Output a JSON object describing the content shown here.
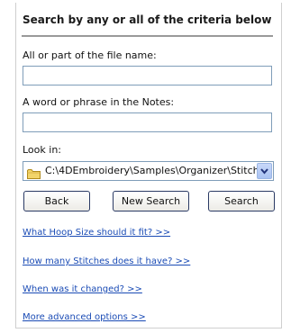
{
  "search": {
    "heading": "Search by any or all of the criteria below",
    "filename_label": "All or part of the file name:",
    "filename_value": "",
    "notes_label": "A word or phrase in the Notes:",
    "notes_value": "",
    "lookin_label": "Look in:",
    "lookin_value": "C:\\4DEmbroidery\\Samples\\Organizer\\Stitch",
    "folder_icon": "folder-icon",
    "dropdown_icon": "chevron-down-icon"
  },
  "buttons": {
    "back": "Back",
    "new_search": "New Search",
    "search": "Search"
  },
  "links": [
    "What Hoop Size should it fit? >>",
    "How many Stitches does it have? >>",
    "When was it changed? >>",
    "More advanced options >>"
  ]
}
